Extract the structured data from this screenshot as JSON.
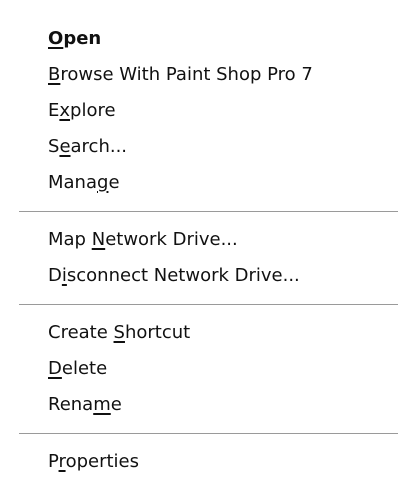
{
  "menu": {
    "groups": [
      {
        "items": [
          {
            "name": "menu-item-open",
            "bold": true,
            "pre": "",
            "key": "O",
            "post": "pen"
          },
          {
            "name": "menu-item-browse-with-paint-shop-pro",
            "bold": false,
            "pre": "",
            "key": "B",
            "post": "rowse With Paint Shop Pro 7"
          },
          {
            "name": "menu-item-explore",
            "bold": false,
            "pre": "E",
            "key": "x",
            "post": "plore"
          },
          {
            "name": "menu-item-search",
            "bold": false,
            "pre": "S",
            "key": "e",
            "post": "arch..."
          },
          {
            "name": "menu-item-manage",
            "bold": false,
            "pre": "Mana",
            "key": "g",
            "post": "e"
          }
        ]
      },
      {
        "items": [
          {
            "name": "menu-item-map-network-drive",
            "bold": false,
            "pre": "Map ",
            "key": "N",
            "post": "etwork Drive..."
          },
          {
            "name": "menu-item-disconnect-network-drive",
            "bold": false,
            "pre": "D",
            "key": "i",
            "post": "sconnect Network Drive..."
          }
        ]
      },
      {
        "items": [
          {
            "name": "menu-item-create-shortcut",
            "bold": false,
            "pre": "Create ",
            "key": "S",
            "post": "hortcut"
          },
          {
            "name": "menu-item-delete",
            "bold": false,
            "pre": "",
            "key": "D",
            "post": "elete"
          },
          {
            "name": "menu-item-rename",
            "bold": false,
            "pre": "Rena",
            "key": "m",
            "post": "e"
          }
        ]
      },
      {
        "items": [
          {
            "name": "menu-item-properties",
            "bold": false,
            "pre": "P",
            "key": "r",
            "post": "operties"
          }
        ]
      }
    ]
  }
}
